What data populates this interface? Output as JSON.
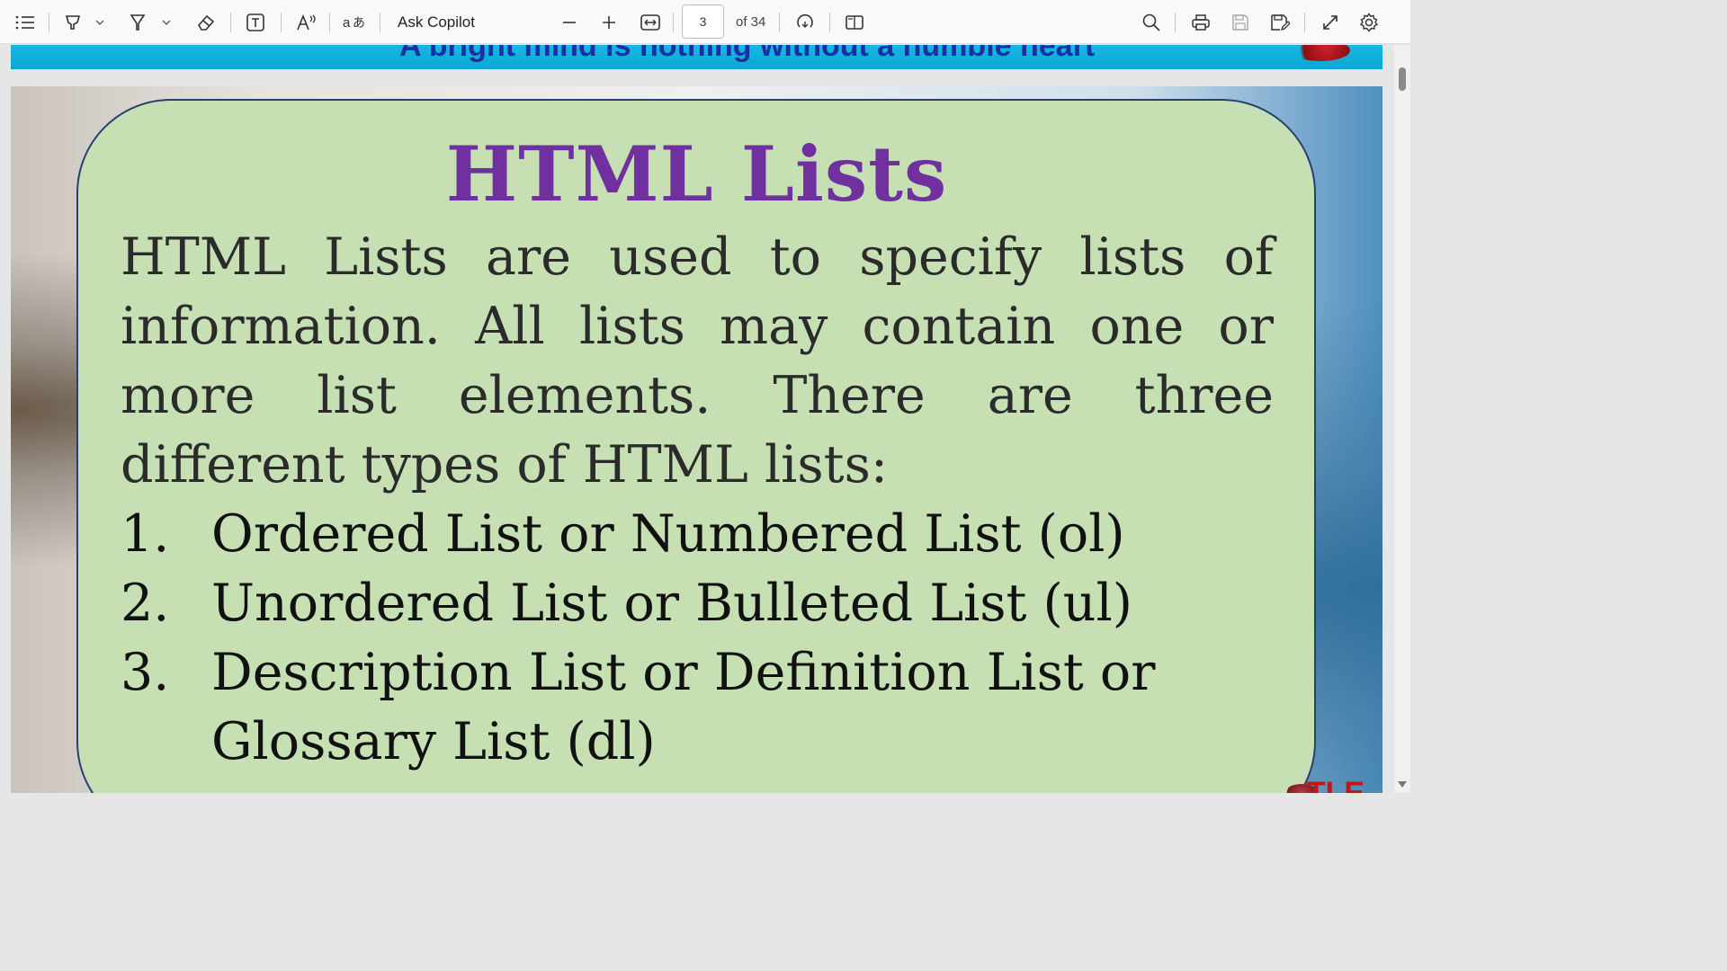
{
  "toolbar": {
    "ask_copilot": "Ask Copilot",
    "page_number": "3",
    "page_of": "of 34",
    "icons": [
      "contents-icon",
      "highlight-icon",
      "draw-icon",
      "eraser-icon",
      "text-box-icon",
      "read-aloud-icon",
      "translate-icon",
      "zoom-out-icon",
      "zoom-in-icon",
      "fit-width-icon",
      "rotate-icon",
      "page-view-icon",
      "search-icon",
      "print-icon",
      "save-icon",
      "save-as-icon",
      "fullscreen-icon",
      "settings-icon"
    ]
  },
  "document": {
    "previous_page_banner": "A bright mind is nothing without a humble heart",
    "slide": {
      "title": "HTML Lists",
      "paragraph": "HTML Lists are used to specify lists of information. All lists may contain one or more list elements. There are three different types of HTML lists:",
      "list": [
        {
          "num": "1.",
          "text": "Ordered List or Numbered List (ol)"
        },
        {
          "num": "2.",
          "text": "Unordered List or Bulleted List (ul)"
        },
        {
          "num": "3.",
          "text": "Description List or Definition List or Glossary List (dl)"
        }
      ],
      "logo_text": "TLE"
    }
  },
  "colors": {
    "title": "#7030a0",
    "card_background": "#c6e0b4",
    "banner": "#0aa8d4"
  }
}
